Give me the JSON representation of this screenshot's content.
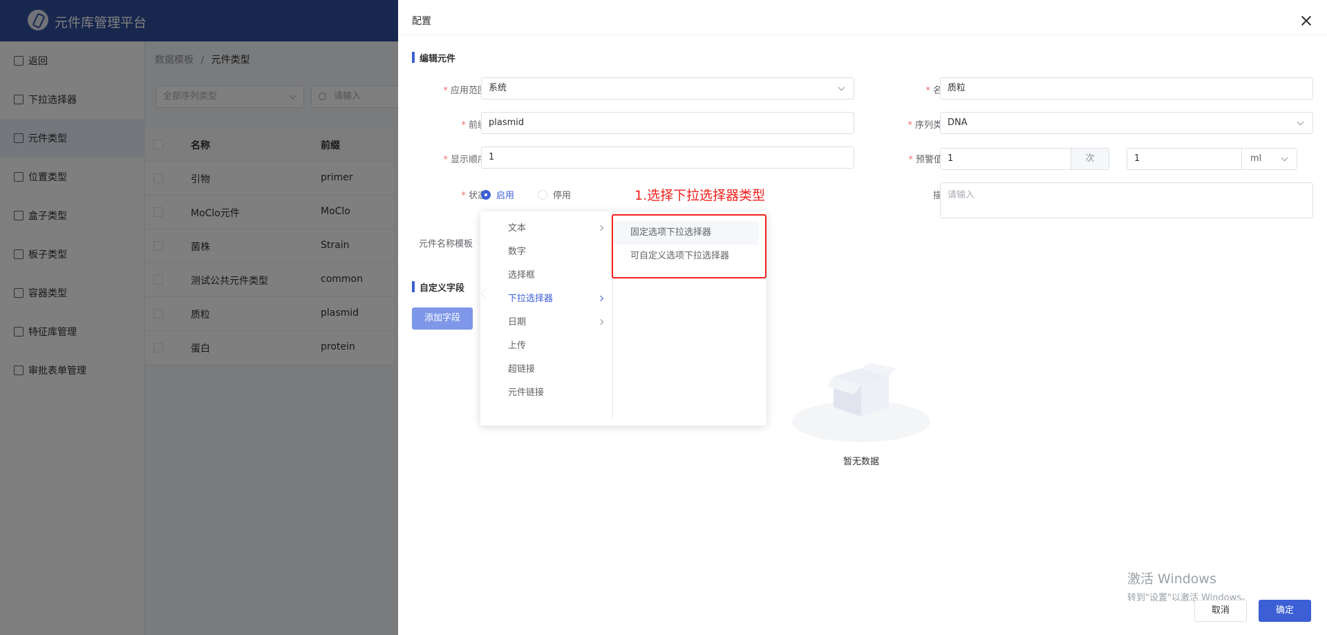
{
  "app": {
    "title": "元件库管理平台"
  },
  "sidebar": {
    "items": [
      {
        "label": "返回"
      },
      {
        "label": "下拉选择器"
      },
      {
        "label": "元件类型"
      },
      {
        "label": "位置类型"
      },
      {
        "label": "盒子类型"
      },
      {
        "label": "板子类型"
      },
      {
        "label": "容器类型"
      },
      {
        "label": "特征库管理"
      },
      {
        "label": "审批表单管理"
      }
    ]
  },
  "breadcrumb": {
    "parent": "数据模板",
    "separator": "/",
    "current": "元件类型"
  },
  "filters": {
    "sequence_type_placeholder": "全部序列类型",
    "search_placeholder": "请输入"
  },
  "table": {
    "headers": {
      "name": "名称",
      "prefix": "前缀"
    },
    "rows": [
      {
        "name": "引物",
        "prefix": "primer"
      },
      {
        "name": "MoClo元件",
        "prefix": "MoClo"
      },
      {
        "name": "菌株",
        "prefix": "Strain"
      },
      {
        "name": "测试公共元件类型",
        "prefix": "common"
      },
      {
        "name": "质粒",
        "prefix": "plasmid"
      },
      {
        "name": "蛋白",
        "prefix": "protein"
      }
    ]
  },
  "drawer": {
    "title": "配置",
    "section_edit": "编辑元件",
    "section_custom": "自定义字段",
    "form": {
      "scope": {
        "label": "应用范围",
        "value": "系统"
      },
      "name": {
        "label": "名称",
        "value": "质粒"
      },
      "prefix": {
        "label": "前缀",
        "value": "plasmid"
      },
      "seq_type": {
        "label": "序列类型",
        "value": "DNA"
      },
      "order": {
        "label": "显示顺序",
        "value": "1"
      },
      "warning": {
        "label": "预警值",
        "help": "?",
        "value1": "1",
        "unit1": "次",
        "value2": "1",
        "unit2": "ml"
      },
      "status": {
        "label": "状态",
        "on": "启用",
        "off": "停用"
      },
      "desc": {
        "label": "描述",
        "placeholder": "请输入"
      },
      "name_template": {
        "label": "元件名称模板"
      },
      "required_mark": "*"
    },
    "add_field_button": "添加字段",
    "empty_text": "暂无数据",
    "cancel": "取消",
    "ok": "确定"
  },
  "cascader": {
    "level1": [
      {
        "label": "文本",
        "has_children": true
      },
      {
        "label": "数字",
        "has_children": false
      },
      {
        "label": "选择框",
        "has_children": false
      },
      {
        "label": "下拉选择器",
        "has_children": true,
        "active": true
      },
      {
        "label": "日期",
        "has_children": true
      },
      {
        "label": "上传",
        "has_children": false
      },
      {
        "label": "超链接",
        "has_children": false
      },
      {
        "label": "元件链接",
        "has_children": false
      }
    ],
    "level2": [
      {
        "label": "固定选项下拉选择器"
      },
      {
        "label": "可自定义选项下拉选择器"
      }
    ]
  },
  "annotation": {
    "text": "1.选择下拉选择器类型",
    "color": "#f0201c"
  },
  "watermark": {
    "line1": "激活 Windows",
    "line2": "转到\"设置\"以激活 Windows。"
  },
  "colors": {
    "primary": "#3c5fd6",
    "topbar": "#2f4f9c",
    "danger": "#f56c6c"
  }
}
